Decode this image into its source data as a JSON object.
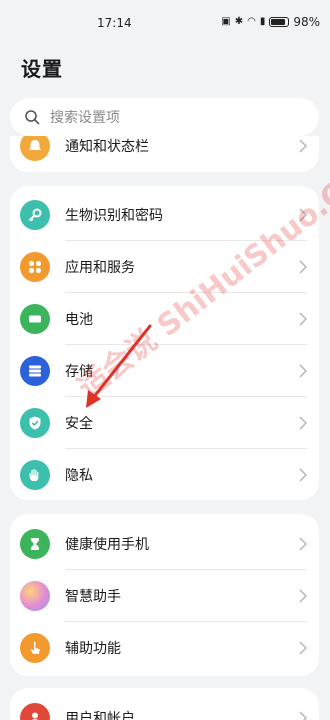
{
  "status": {
    "time": "17:14",
    "battery": "98%"
  },
  "page": {
    "title": "设置"
  },
  "search": {
    "placeholder": "搜索设置项"
  },
  "top_item": {
    "label": "通知和状态栏",
    "color": "#f2a93b"
  },
  "group_a": [
    {
      "label": "生物识别和密码",
      "icon": "key-icon",
      "color": "#3dbfae"
    },
    {
      "label": "应用和服务",
      "icon": "apps-grid-icon",
      "color": "#f29a2e"
    },
    {
      "label": "电池",
      "icon": "battery-icon",
      "color": "#3bb45c"
    },
    {
      "label": "存储",
      "icon": "storage-icon",
      "color": "#2b62d9"
    },
    {
      "label": "安全",
      "icon": "shield-icon",
      "color": "#3dbfae"
    },
    {
      "label": "隐私",
      "icon": "hand-icon",
      "color": "#3dbfae"
    }
  ],
  "group_b": [
    {
      "label": "健康使用手机",
      "icon": "hourglass-icon",
      "color": "#3bb45c"
    },
    {
      "label": "智慧助手",
      "icon": "assistant-orb-icon",
      "color": "#c77de8"
    },
    {
      "label": "辅助功能",
      "icon": "touch-hand-icon",
      "color": "#f29a2e"
    }
  ],
  "group_c": [
    {
      "label": "用户和帐户",
      "icon": "user-icon",
      "color": "#e0483a"
    }
  ],
  "watermark": "适会说 ShiHuiShuo.Com"
}
